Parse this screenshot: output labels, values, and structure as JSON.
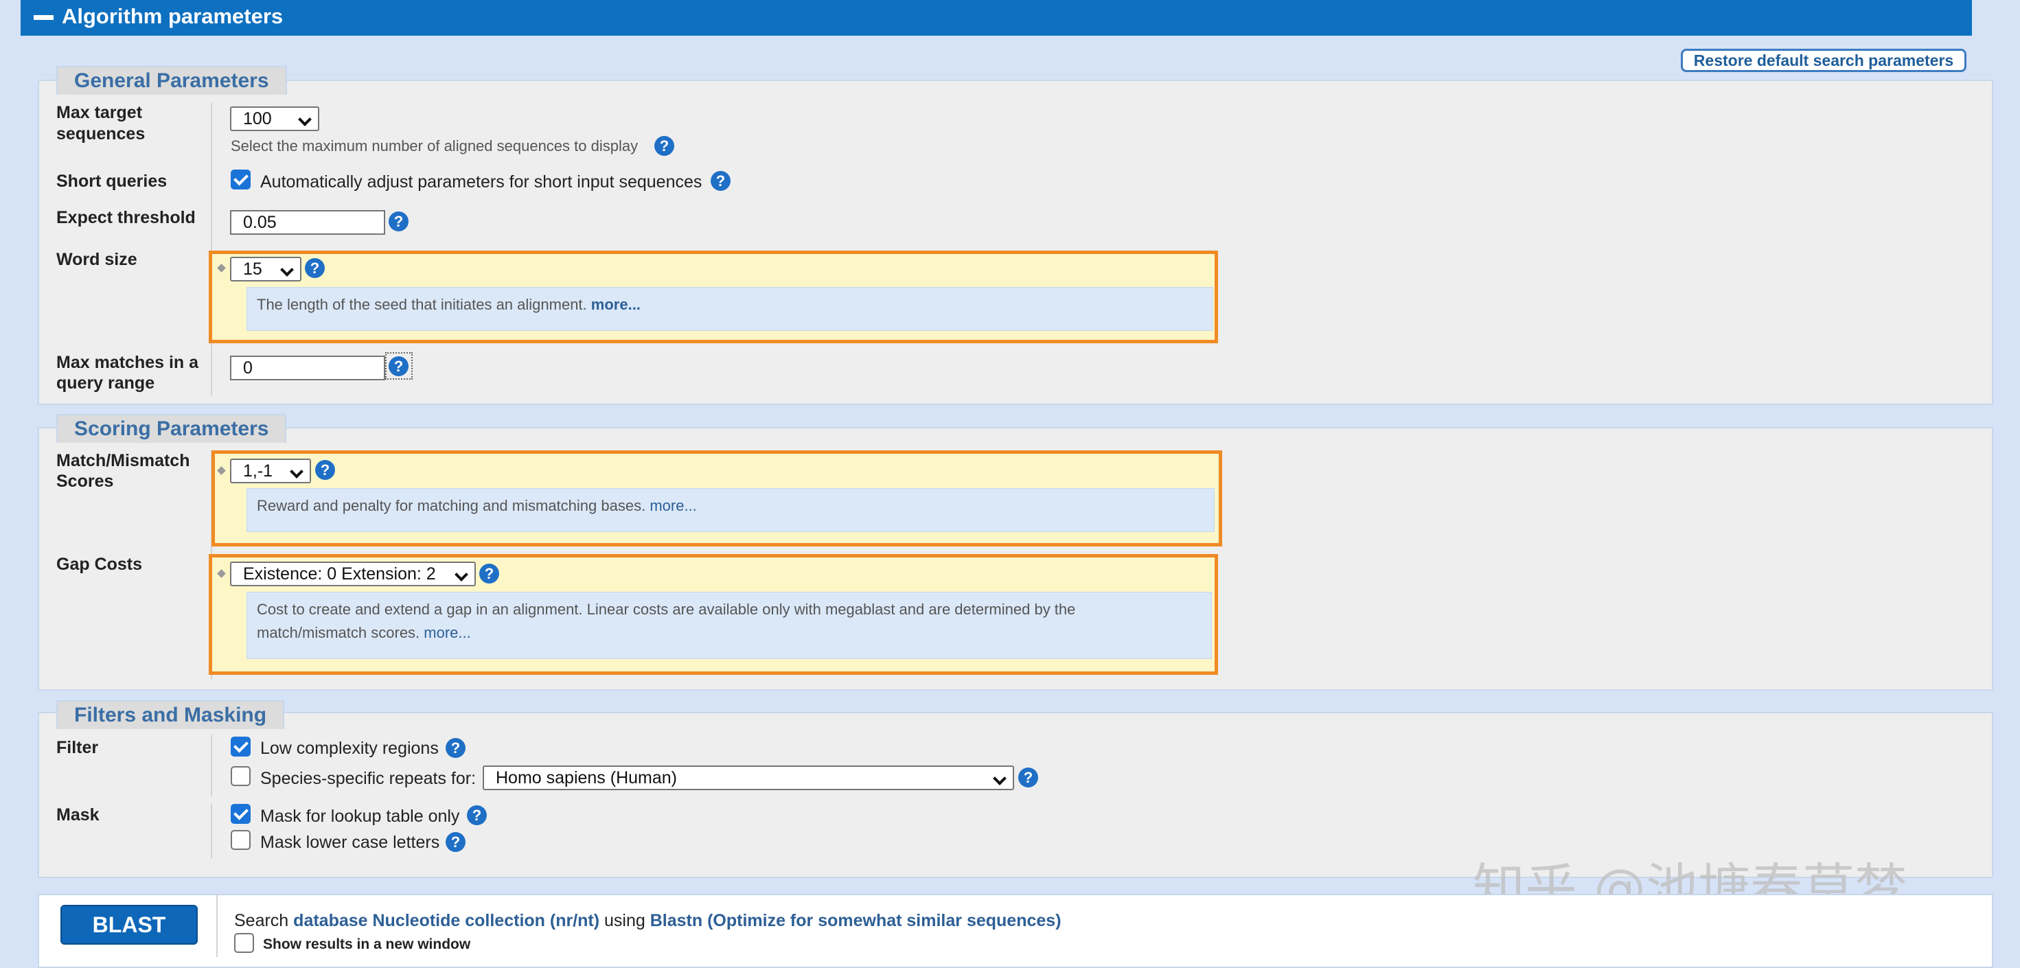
{
  "header": {
    "title": "Algorithm parameters"
  },
  "restore_button": "Restore default search parameters",
  "general": {
    "legend": "General Parameters",
    "max_target": {
      "label_1": "Max target",
      "label_2": "sequences",
      "value": "100",
      "hint": "Select the maximum number of aligned sequences to display"
    },
    "short_queries": {
      "label": "Short queries",
      "checked": true,
      "text": "Automatically adjust parameters for short input sequences"
    },
    "expect": {
      "label": "Expect threshold",
      "value": "0.05"
    },
    "word_size": {
      "label": "Word size",
      "value": "15",
      "desc": "The length of the seed that initiates an alignment.",
      "more": "more..."
    },
    "max_matches": {
      "label_1": "Max matches in a",
      "label_2": "query range",
      "value": "0"
    }
  },
  "scoring": {
    "legend": "Scoring Parameters",
    "match_mismatch": {
      "label_1": "Match/Mismatch",
      "label_2": "Scores",
      "value": "1,-1",
      "desc": "Reward and penalty for matching and mismatching bases.",
      "more": "more..."
    },
    "gap_costs": {
      "label": "Gap Costs",
      "value": "Existence: 0 Extension: 2",
      "desc_1": "Cost to create and extend a gap in an alignment. Linear costs are available only with megablast and are determined by the",
      "desc_2": "match/mismatch scores.",
      "more": "more..."
    }
  },
  "filters": {
    "legend": "Filters and Masking",
    "filter_label": "Filter",
    "low_complexity": {
      "checked": true,
      "text": "Low complexity regions"
    },
    "species": {
      "checked": false,
      "text": "Species-specific repeats for:",
      "value": "Homo sapiens (Human)"
    },
    "mask_label": "Mask",
    "mask_lookup": {
      "checked": true,
      "text": "Mask for lookup table only"
    },
    "mask_lower": {
      "checked": false,
      "text": "Mask lower case letters"
    }
  },
  "submit": {
    "button": "BLAST",
    "search": "Search",
    "database": "database Nucleotide collection (nr/nt)",
    "using": "using",
    "program": "Blastn (Optimize for somewhat similar sequences)",
    "new_window": "Show results in a new window",
    "new_window_checked": false
  },
  "watermark": "知乎 @池塘春草梦",
  "colors": {
    "header": "#0e70c0",
    "highlight_border": "#f08a24",
    "highlight_bg": "#fdf7c8",
    "help_icon": "#1f6fc6"
  }
}
